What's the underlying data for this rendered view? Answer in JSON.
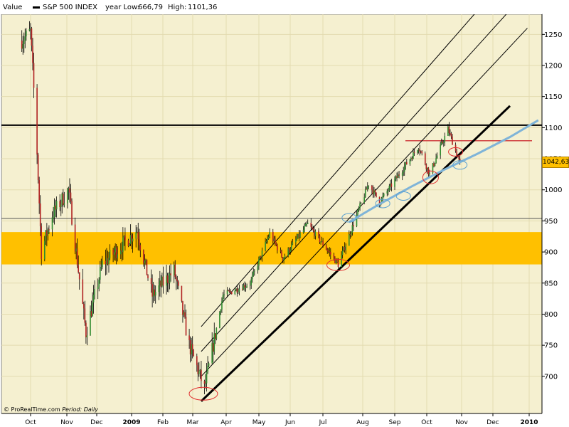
{
  "header": {
    "value_label": "Value",
    "series_name": "S&P 500 INDEX",
    "year_low_label": "year Low:",
    "year_low": "666,79",
    "high_label": "High:",
    "high": "1101,36"
  },
  "footer": {
    "source": "© ProRealTime.com",
    "period_label": "Period:",
    "period": "Daily"
  },
  "current_price": "1042,63",
  "chart_data": {
    "type": "candlestick",
    "title": "S&P 500 INDEX",
    "ylim": [
      640,
      1295
    ],
    "y_ticks": [
      "1250",
      "1200",
      "1150",
      "1100",
      "1050",
      "1000",
      "950",
      "900",
      "850",
      "800",
      "750",
      "700"
    ],
    "x_ticks": [
      "Oct",
      "Nov",
      "Dec",
      "2009",
      "Feb",
      "Mar",
      "Apr",
      "May",
      "Jun",
      "Jul",
      "Aug",
      "Sep",
      "Oct",
      "Nov",
      "Dec",
      "2010"
    ],
    "grid": true,
    "support_band": [
      880,
      932
    ],
    "horizontal_levels": [
      {
        "level": 1104,
        "color": "#000000"
      },
      {
        "level": 954,
        "color": "#000000"
      },
      {
        "level": 1079,
        "color": "#d04040"
      }
    ],
    "trend_lines": [
      {
        "from": [
          "2009-03-06",
          660
        ],
        "to": [
          "2009-12-15",
          1135
        ],
        "role": "support"
      },
      {
        "from": [
          "2009-03-06",
          700
        ],
        "to": [
          "2009-12-31",
          1260
        ],
        "role": "channel"
      },
      {
        "from": [
          "2009-03-06",
          740
        ],
        "to": [
          "2009-12-31",
          1320
        ],
        "role": "channel"
      },
      {
        "from": [
          "2009-03-06",
          780
        ],
        "to": [
          "2009-12-31",
          1380
        ],
        "role": "channel"
      }
    ],
    "moving_average_color": "#7fb4d8",
    "series_key_points": [
      {
        "date": "2008-09-22",
        "value": 1240
      },
      {
        "date": "2008-09-30",
        "value": 1255
      },
      {
        "date": "2008-10-05",
        "value": 1100
      },
      {
        "date": "2008-10-10",
        "value": 900
      },
      {
        "date": "2008-10-20",
        "value": 960
      },
      {
        "date": "2008-11-04",
        "value": 1000
      },
      {
        "date": "2008-11-20",
        "value": 770
      },
      {
        "date": "2008-12-05",
        "value": 880
      },
      {
        "date": "2009-01-06",
        "value": 935
      },
      {
        "date": "2009-01-20",
        "value": 830
      },
      {
        "date": "2009-02-09",
        "value": 870
      },
      {
        "date": "2009-02-23",
        "value": 750
      },
      {
        "date": "2009-03-09",
        "value": 680
      },
      {
        "date": "2009-03-26",
        "value": 830
      },
      {
        "date": "2009-04-20",
        "value": 850
      },
      {
        "date": "2009-05-08",
        "value": 930
      },
      {
        "date": "2009-05-20",
        "value": 890
      },
      {
        "date": "2009-06-12",
        "value": 945
      },
      {
        "date": "2009-07-10",
        "value": 880
      },
      {
        "date": "2009-08-07",
        "value": 1010
      },
      {
        "date": "2009-08-17",
        "value": 980
      },
      {
        "date": "2009-09-22",
        "value": 1070
      },
      {
        "date": "2009-10-02",
        "value": 1025
      },
      {
        "date": "2009-10-19",
        "value": 1098
      },
      {
        "date": "2009-10-30",
        "value": 1042
      }
    ]
  }
}
